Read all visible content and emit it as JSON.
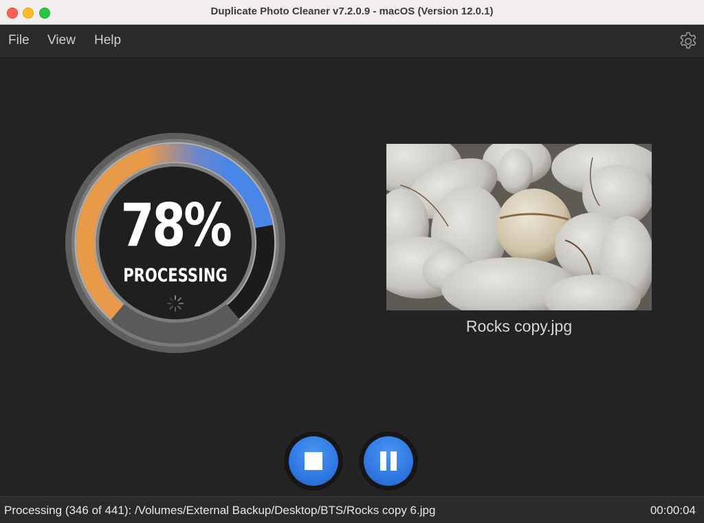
{
  "window": {
    "title": "Duplicate Photo Cleaner v7.2.0.9 - macOS (Version 12.0.1)"
  },
  "menu": {
    "items": [
      {
        "label": "File"
      },
      {
        "label": "View"
      },
      {
        "label": "Help"
      }
    ],
    "settings_icon": "gear-icon"
  },
  "progress": {
    "percent_text": "78%",
    "fraction": 0.78,
    "label": "PROCESSING"
  },
  "preview": {
    "filename": "Rocks copy.jpg"
  },
  "controls": {
    "stop_icon": "stop-icon",
    "pause_icon": "pause-icon"
  },
  "status": {
    "text": "Processing (346 of 441): /Volumes/External Backup/Desktop/BTS/Rocks copy 6.jpg",
    "elapsed": "00:00:04"
  },
  "colors": {
    "accent_blue": "#4a86e8",
    "accent_orange": "#e89a48",
    "background": "#232323"
  }
}
